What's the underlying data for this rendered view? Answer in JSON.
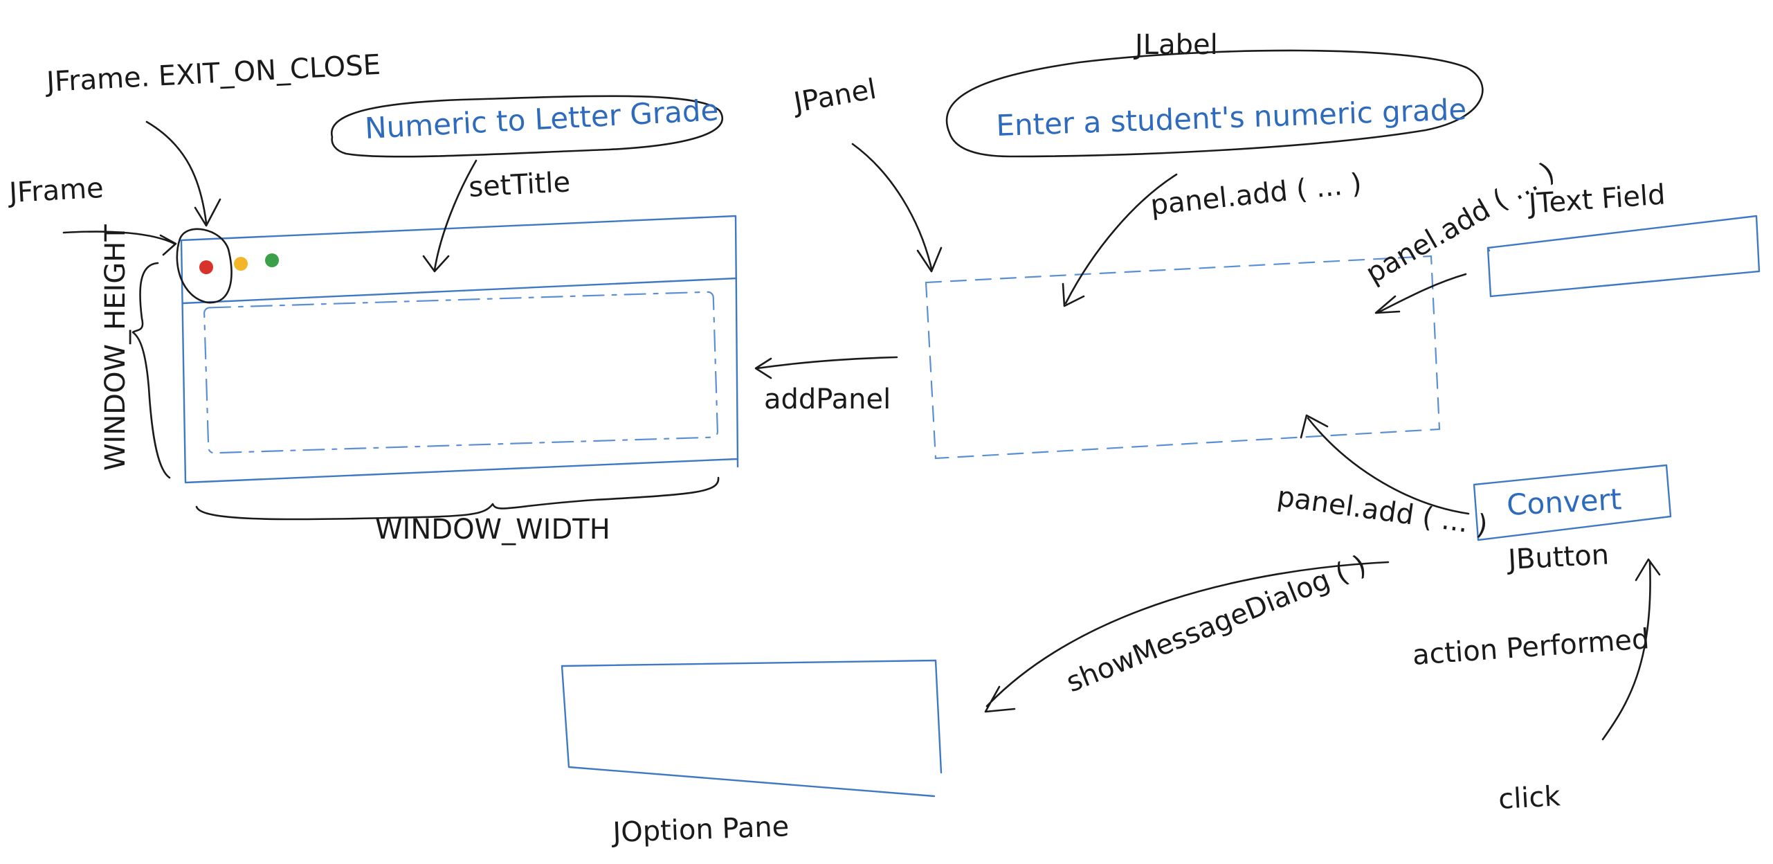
{
  "labels": {
    "exit_on_close": "JFrame. EXIT_ON_CLOSE",
    "jframe": "JFrame",
    "window_title": "Numeric to Letter Grade",
    "set_title": "setTitle",
    "window_height": "WINDOW_HEIGHT",
    "window_width": "WINDOW_WIDTH",
    "add_panel": "addPanel",
    "jpanel": "JPanel",
    "jlabel": "JLabel",
    "label_text": "Enter a student's numeric grade",
    "panel_add_label": "panel.add ( ... )",
    "panel_add_textfield": "panel.add ( ... )",
    "jtextfield": "JText Field",
    "panel_add_button": "panel.add ( ... )",
    "button_text": "Convert",
    "jbutton": "JButton",
    "action_performed": "action Performed",
    "click": "click",
    "show_message_dialog": "showMessageDialog ( )",
    "joptionpane": "JOption Pane"
  },
  "colors": {
    "ink": "#1a1a1a",
    "blue": "#3f78c4",
    "close_dot": "#d8322a",
    "minimize_dot": "#f2b628",
    "zoom_dot": "#3aa04a"
  }
}
